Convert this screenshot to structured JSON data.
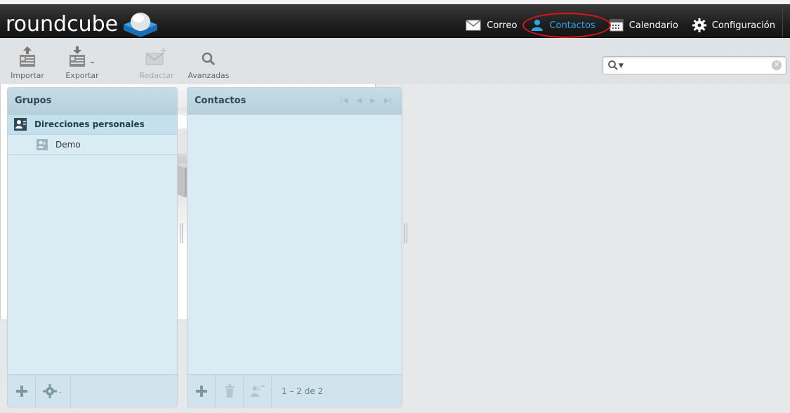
{
  "app": {
    "logo_text": "roundcube"
  },
  "topnav": {
    "items": [
      {
        "label": "Correo",
        "icon": "envelope-icon",
        "active": false
      },
      {
        "label": "Contactos",
        "icon": "user-icon",
        "active": true
      },
      {
        "label": "Calendario",
        "icon": "calendar-icon",
        "active": false
      },
      {
        "label": "Configuración",
        "icon": "gear-icon",
        "active": false
      }
    ]
  },
  "toolbar": {
    "import_label": "Importar",
    "export_label": "Exportar",
    "compose_label": "Redactar",
    "advanced_label": "Avanzadas"
  },
  "search": {
    "placeholder": "",
    "value": ""
  },
  "groups_panel": {
    "title": "Grupos",
    "items": [
      {
        "label": "Direcciones personales",
        "selected": true
      },
      {
        "label": "Demo",
        "selected": false
      }
    ]
  },
  "contacts_panel": {
    "title": "Contactos",
    "count_text": "1 – 2 de 2"
  },
  "colors": {
    "accent": "#2aa7e3",
    "highlight_ring": "#e0141b",
    "panel_bg": "#d9ecf4"
  }
}
